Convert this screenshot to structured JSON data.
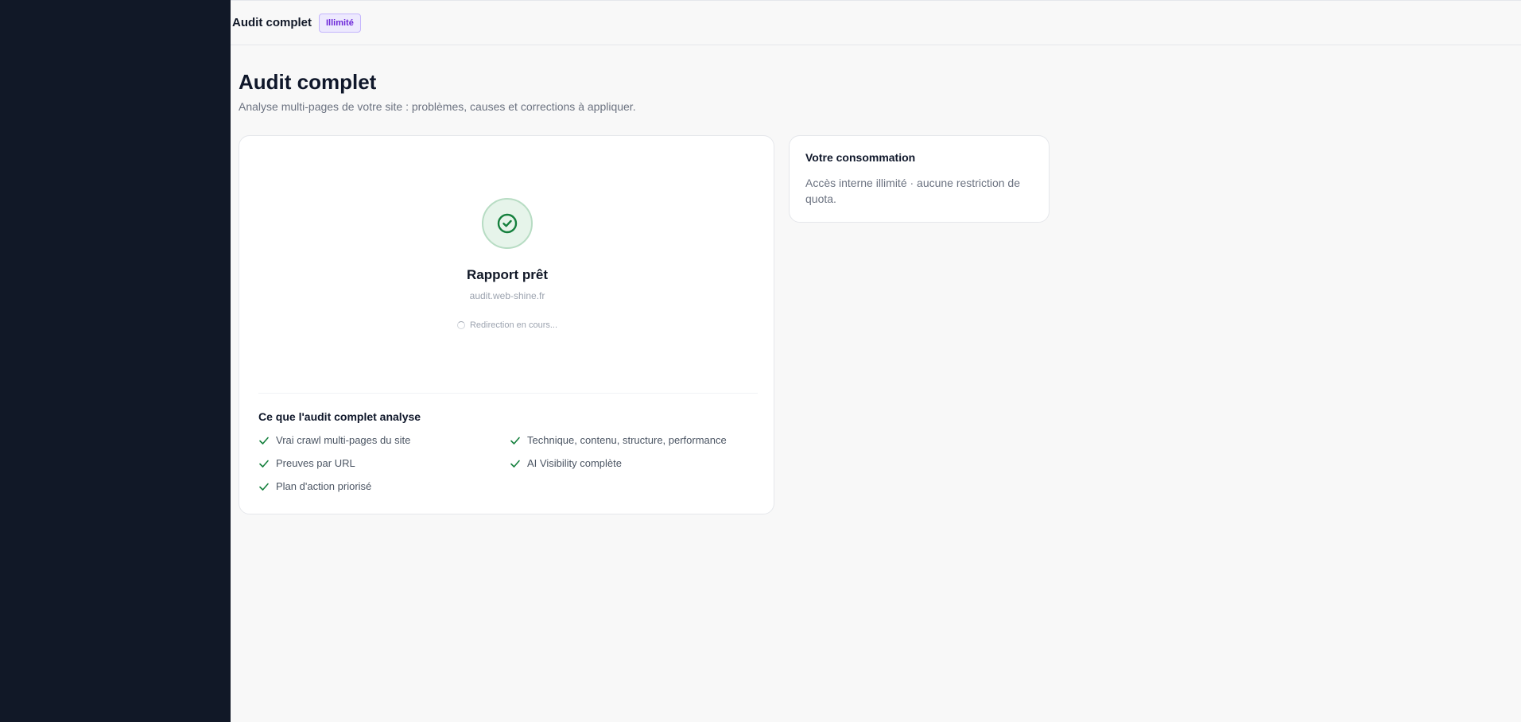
{
  "header": {
    "title": "Audit complet",
    "badge": "Illimité"
  },
  "page": {
    "title": "Audit complet",
    "subtitle": "Analyse multi-pages de votre site : problèmes, causes et corrections à appliquer."
  },
  "report": {
    "status_icon": "check-circle-icon",
    "title": "Rapport prêt",
    "domain": "audit.web-shine.fr",
    "redirect_text": "Redirection en cours..."
  },
  "features": {
    "title": "Ce que l'audit complet analyse",
    "items": [
      "Vrai crawl multi-pages du site",
      "Technique, contenu, structure, performance",
      "Preuves par URL",
      "AI Visibility complète",
      "Plan d'action priorisé"
    ]
  },
  "usage": {
    "title": "Votre consommation",
    "description": "Accès interne illimité · aucune restriction de quota."
  },
  "colors": {
    "sidebar": "#111827",
    "background": "#f8f8f8",
    "success": "#15803d",
    "badge_bg": "#ede9fe",
    "badge_text": "#6d28d9"
  }
}
